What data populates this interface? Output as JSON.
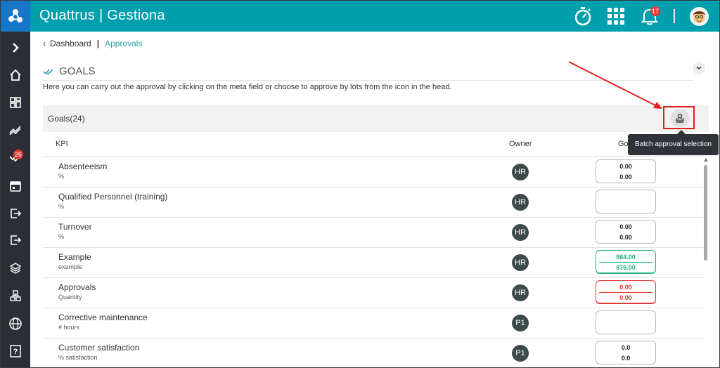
{
  "app": {
    "title": "Quattrus | Gestiona"
  },
  "header": {
    "notification_count": "17",
    "icons": [
      "stopwatch-icon",
      "apps-grid-icon",
      "bell-icon",
      "avatar"
    ]
  },
  "sidebar": {
    "items": [
      {
        "name": "expand-icon"
      },
      {
        "name": "home-icon"
      },
      {
        "name": "dashboard-icon"
      },
      {
        "name": "trend-icon"
      },
      {
        "name": "approvals-icon",
        "badge": "26"
      },
      {
        "name": "calendar-icon"
      },
      {
        "name": "exit-icon"
      },
      {
        "name": "logout-icon"
      },
      {
        "name": "layers-icon"
      },
      {
        "name": "org-chart-icon"
      },
      {
        "name": "globe-icon"
      },
      {
        "name": "help-icon"
      }
    ]
  },
  "breadcrumb": {
    "home": "Dashboard",
    "separator": "|",
    "current": "Approvals"
  },
  "section": {
    "title": "GOALS",
    "description": "Here you can carry out the approval by clicking on the meta field or choose to approve by lots from the icon in the head."
  },
  "panel": {
    "title": "Goals(24)",
    "tooltip": "Batch approval selection"
  },
  "table": {
    "columns": {
      "kpi": "KPI",
      "owner": "Owner",
      "goal": "Go"
    },
    "rows": [
      {
        "name": "Absenteeism",
        "unit": "%",
        "owner": "HR",
        "goal_top": "0.00",
        "goal_bottom": "0.00",
        "status": "neutral"
      },
      {
        "name": "Qualified Personnel (training)",
        "unit": "%",
        "owner": "HR",
        "goal_top": "",
        "goal_bottom": "",
        "status": "neutral"
      },
      {
        "name": "Turnover",
        "unit": "%",
        "owner": "HR",
        "goal_top": "0.00",
        "goal_bottom": "0.00",
        "status": "neutral"
      },
      {
        "name": "Example",
        "unit": "example",
        "owner": "HR",
        "goal_top": "864.00",
        "goal_bottom": "876.00",
        "status": "green"
      },
      {
        "name": "Approvals",
        "unit": "Quantity",
        "owner": "HR",
        "goal_top": "0.00",
        "goal_bottom": "0.00",
        "status": "red"
      },
      {
        "name": "Corrective maintenance",
        "unit": "# hours",
        "owner": "P1",
        "goal_top": "",
        "goal_bottom": "",
        "status": "neutral"
      },
      {
        "name": "Customer satisfaction",
        "unit": "% satisfaction",
        "owner": "P1",
        "goal_top": "0.0",
        "goal_bottom": "0.0",
        "status": "neutral"
      }
    ]
  },
  "colors": {
    "topbar": "#009fae",
    "logo_bg": "#1677c8",
    "sidebar": "#2b2e34",
    "accent_link": "#2a9fb0",
    "approved_green": "#27b07d",
    "rejected_red": "#e53935",
    "annotation_red": "#e02020"
  }
}
